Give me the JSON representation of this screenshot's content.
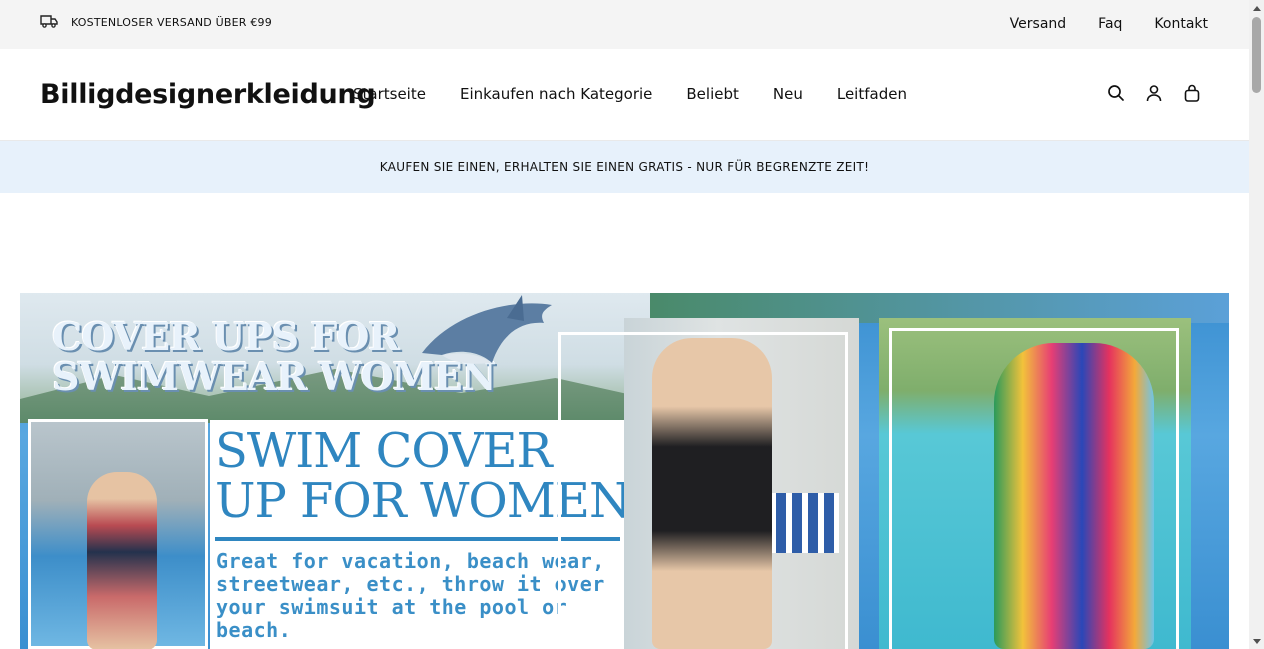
{
  "topbar": {
    "shipping_text": "KOSTENLOSER VERSAND ÜBER €99",
    "links": [
      "Versand",
      "Faq",
      "Kontakt"
    ]
  },
  "header": {
    "logo": "Billigdesignerkleidung",
    "nav": [
      "Startseite",
      "Einkaufen nach Kategorie",
      "Beliebt",
      "Neu",
      "Leitfaden"
    ],
    "icons": [
      "search-icon",
      "account-icon",
      "bag-icon"
    ]
  },
  "promo": {
    "text": "KAUFEN SIE EINEN, ERHALTEN SIE EINEN GRATIS - NUR FÜR BEGRENZTE ZEIT!"
  },
  "hero": {
    "headline_line1": "COVER UPS FOR",
    "headline_line2": "SWIMWEAR WOMEN",
    "title_line1": "SWIM COVER",
    "title_line2": "UP FOR WOMEN",
    "description": "Great for vacation, beach wear, streetwear, etc., throw it over your swimsuit at the pool or beach."
  },
  "colors": {
    "accent_blue": "#2f86c0",
    "promo_bg": "#e7f1fb",
    "topbar_bg": "#f4f4f4"
  }
}
